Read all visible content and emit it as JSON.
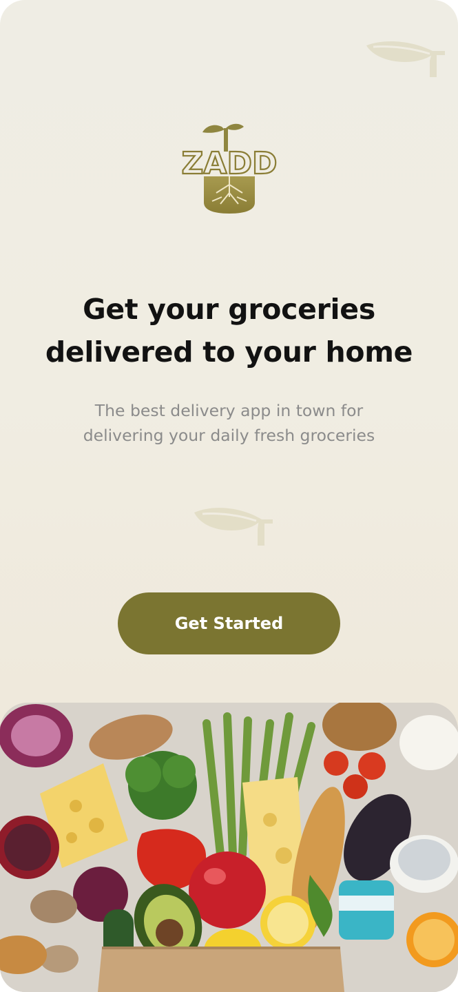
{
  "brand": {
    "logo_text": "ZADD",
    "accent_color": "#7b7531"
  },
  "hero": {
    "title_line1": "Get your groceries",
    "title_line2": "delivered to your home",
    "subtitle_line1": "The best delivery app in town for",
    "subtitle_line2": "delivering your daily fresh groceries"
  },
  "actions": {
    "get_started_label": "Get Started"
  },
  "decor": {
    "leaf_icons": [
      "leaf-icon",
      "leaf-icon"
    ],
    "photo": "grocery-bag-photo"
  }
}
